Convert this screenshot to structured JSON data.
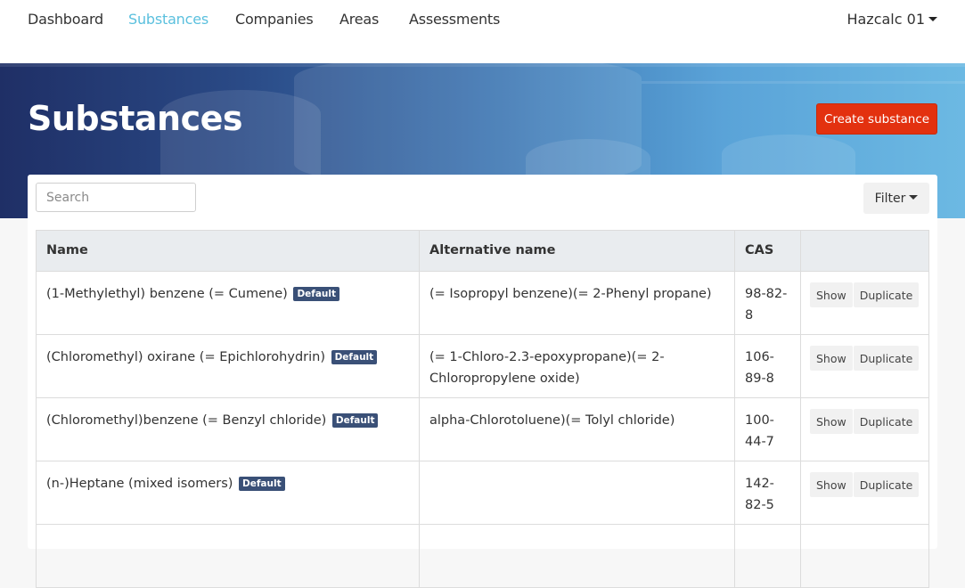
{
  "nav": {
    "items": [
      {
        "label": "Dashboard",
        "active": false
      },
      {
        "label": "Substances",
        "active": true
      },
      {
        "label": "Companies",
        "active": false
      },
      {
        "label": "Areas",
        "active": false
      },
      {
        "label": "Assessments",
        "active": false
      }
    ],
    "user_label": "Hazcalc 01",
    "active_color": "#5bc0de"
  },
  "hero": {
    "title": "Substances",
    "create_label": "Create substance",
    "create_color": "#e3310f"
  },
  "toolbar": {
    "search_placeholder": "Search",
    "filter_label": "Filter"
  },
  "table": {
    "headers": [
      "Name",
      "Alternative name",
      "CAS",
      ""
    ],
    "rows": [
      {
        "name": "(1-Methylethyl) benzene (= Cumene)",
        "badge": "Default",
        "alt": "(= Isopropyl benzene)(= 2-Phenyl propane)",
        "cas": "98-82-8",
        "show": "Show",
        "duplicate": "Duplicate"
      },
      {
        "name": "(Chloromethyl) oxirane (= Epichlorohydrin)",
        "badge": "Default",
        "alt": "(= 1-Chloro-2.3-epoxypropane)(= 2-Chloropropylene oxide)",
        "cas": "106-89-8",
        "show": "Show",
        "duplicate": "Duplicate"
      },
      {
        "name": "(Chloromethyl)benzene (= Benzyl chloride)",
        "badge": "Default",
        "alt": "alpha-Chlorotoluene)(= Tolyl chloride)",
        "cas": "100-44-7",
        "show": "Show",
        "duplicate": "Duplicate"
      },
      {
        "name": "(n-)Heptane (mixed isomers)",
        "badge": "Default",
        "alt": "",
        "cas": "142-82-5",
        "show": "Show",
        "duplicate": "Duplicate"
      },
      {
        "name": "",
        "badge": "",
        "alt": "",
        "cas": "",
        "show": "",
        "duplicate": ""
      }
    ]
  }
}
